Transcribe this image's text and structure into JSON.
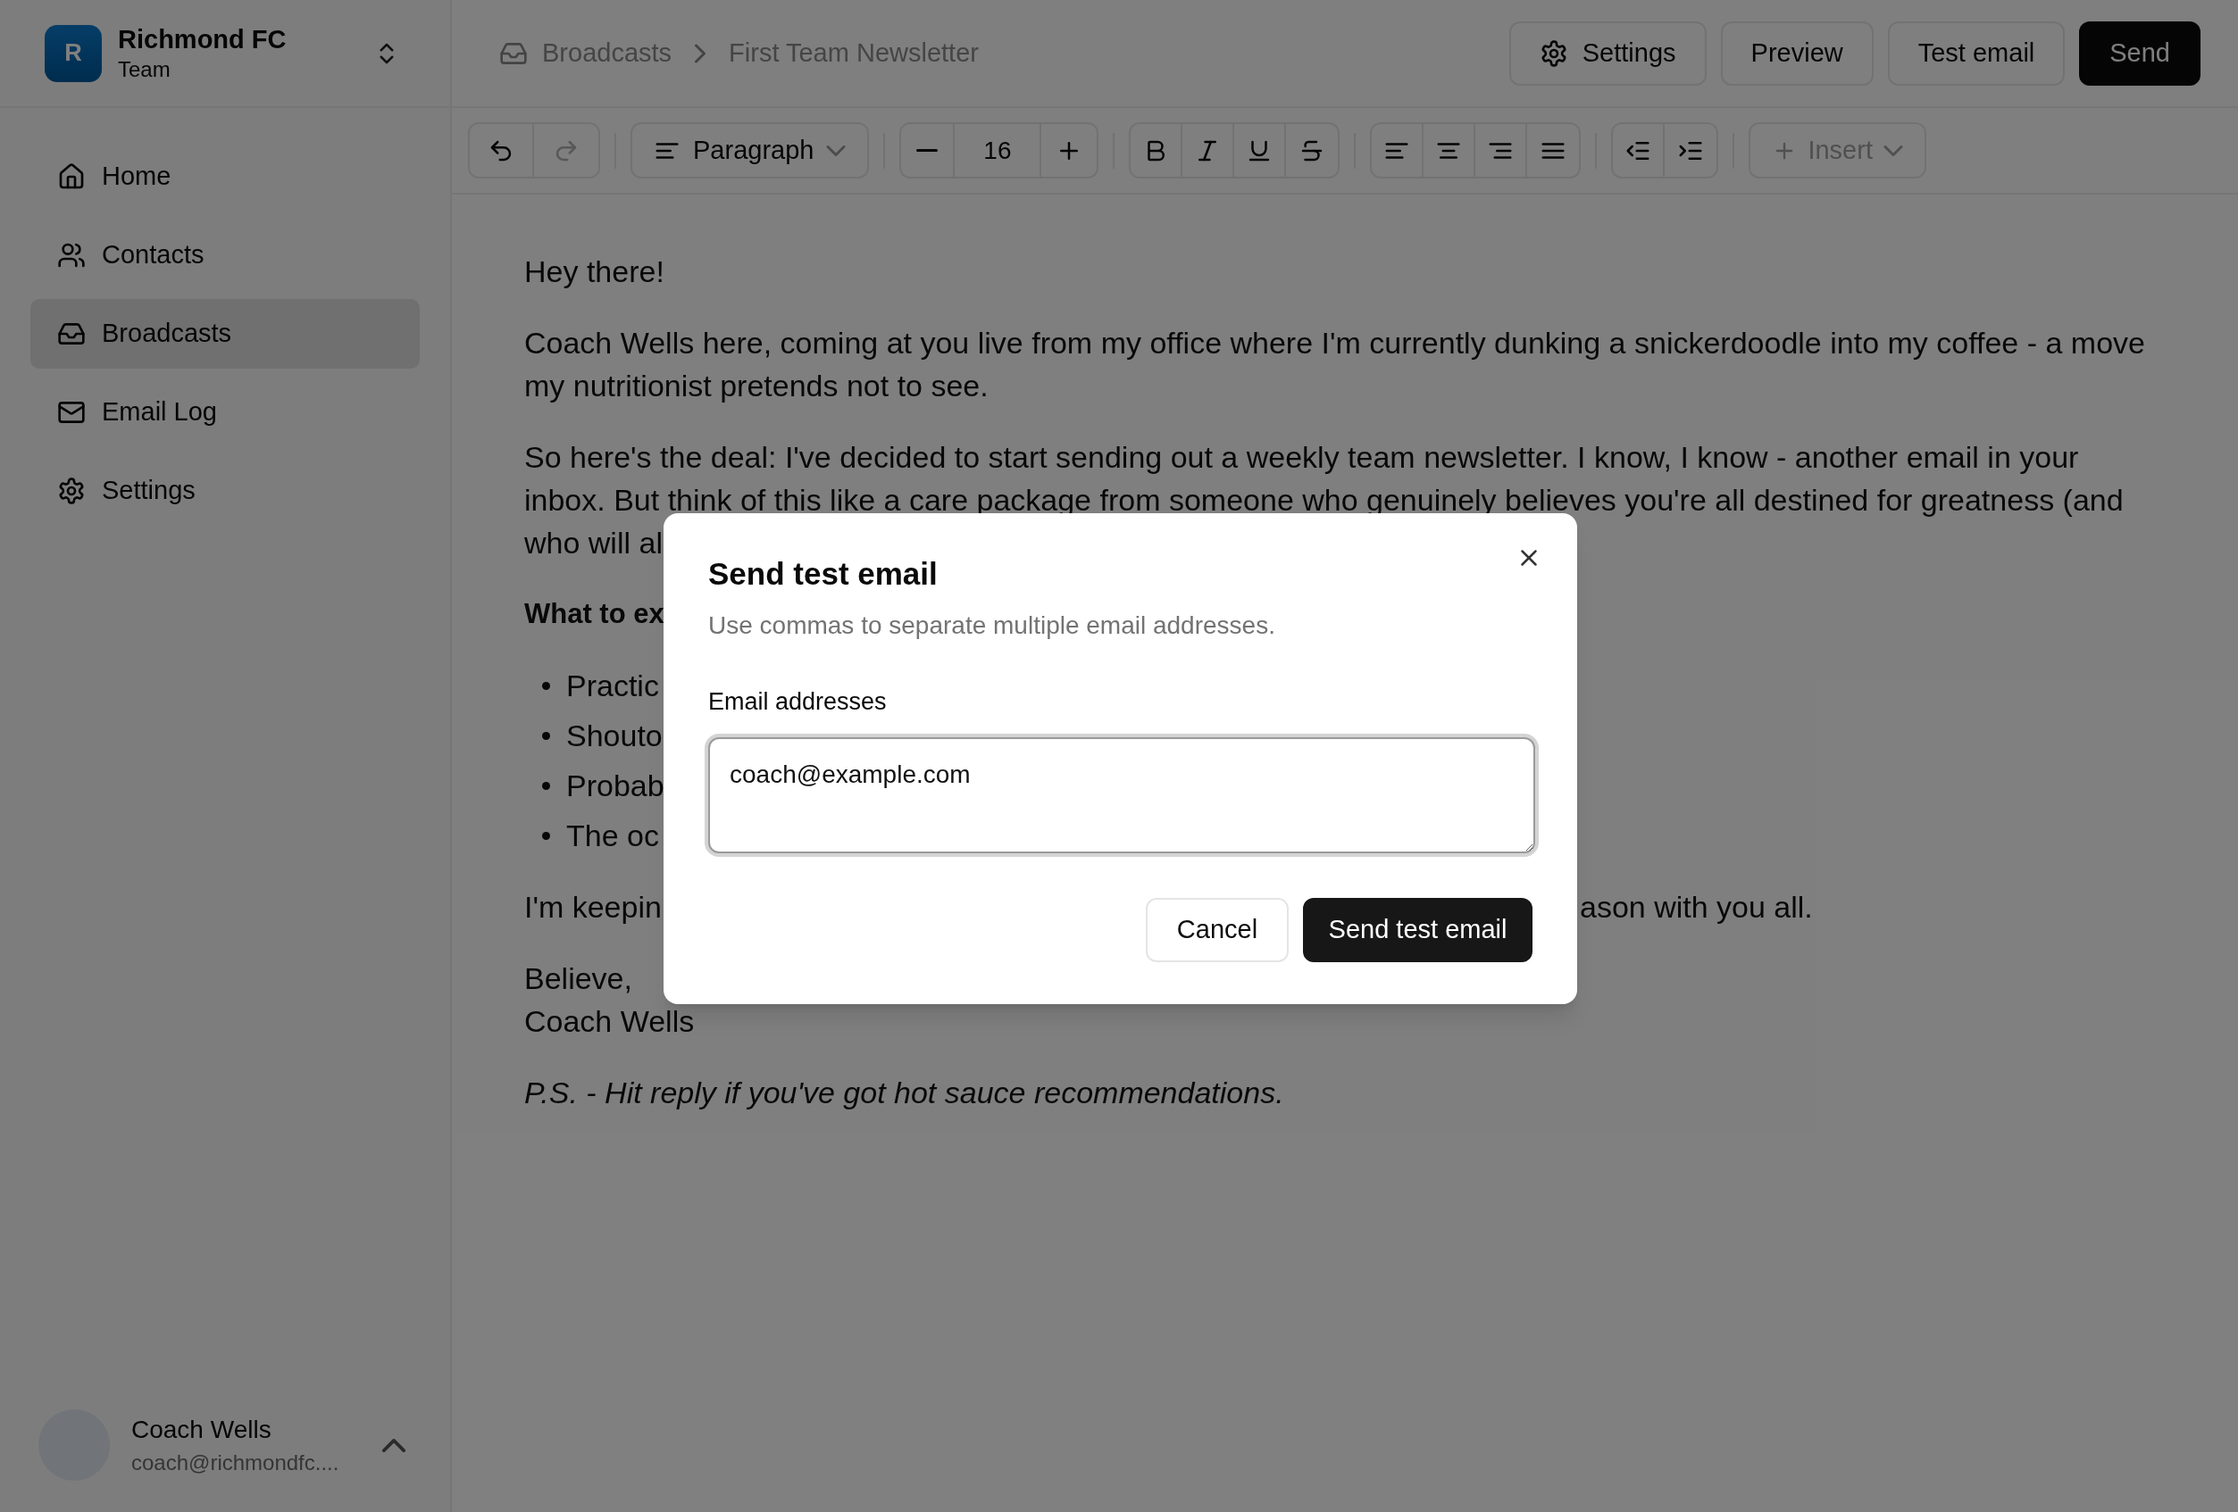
{
  "sidebar": {
    "team": {
      "avatar": "R",
      "name": "Richmond FC",
      "subtitle": "Team"
    },
    "items": [
      {
        "label": "Home",
        "selected": false
      },
      {
        "label": "Contacts",
        "selected": false
      },
      {
        "label": "Broadcasts",
        "selected": true
      },
      {
        "label": "Email Log",
        "selected": false
      },
      {
        "label": "Settings",
        "selected": false
      }
    ],
    "user": {
      "name": "Coach Wells",
      "email": "coach@richmondfc...."
    }
  },
  "breadcrumb": [
    "Broadcasts",
    "First Team Newsletter"
  ],
  "header_buttons": [
    {
      "label": "Settings",
      "kind": "outline"
    },
    {
      "label": "Preview",
      "kind": "outline"
    },
    {
      "label": "Test email",
      "kind": "outline"
    },
    {
      "label": "Send",
      "kind": "primary"
    }
  ],
  "toolbar": {
    "history": [
      {
        "disabled": false
      },
      {
        "disabled": true
      }
    ],
    "block_style": "Paragraph",
    "font_size": "16",
    "insert": {
      "label": "Insert",
      "disabled": true
    }
  },
  "editor": {
    "blocks": [
      {
        "kind": "paragraph",
        "lines": [
          "Hey there!"
        ]
      },
      {
        "kind": "paragraph",
        "lines": [
          "Coach Wells here, coming at you live from my office where I'm currently dunking a snickerdoodle into my coffee - a move",
          "my nutritionist pretends not to see."
        ]
      },
      {
        "kind": "paragraph",
        "lines": [
          "So here's the deal: I've decided to start sending out a weekly team newsletter. I know, I know - another email in your",
          "inbox. But think of this like a care package from someone who genuinely believes you're all destined for greatness (and",
          "who will al"
        ]
      },
      {
        "kind": "heading",
        "lines": [
          "What to ex"
        ]
      },
      {
        "kind": "bullets",
        "lines": [
          "Practic",
          "Shouto",
          "Probab",
          "The oc"
        ]
      },
      {
        "kind": "split",
        "lines": [
          "I'm keepin",
          "ason with you all."
        ]
      },
      {
        "kind": "paragraph",
        "lines": [
          "Believe,",
          "Coach Wells"
        ]
      },
      {
        "kind": "italic",
        "lines": [
          "P.S. - Hit reply if you've got hot sauce recommendations."
        ]
      }
    ]
  },
  "dialog": {
    "title": "Send test email",
    "description": "Use commas to separate multiple email addresses.",
    "field_label": "Email addresses",
    "field_value": "coach@example.com",
    "buttons": [
      {
        "label": "Cancel",
        "kind": "outline"
      },
      {
        "label": "Send test email",
        "kind": "primary"
      }
    ]
  }
}
